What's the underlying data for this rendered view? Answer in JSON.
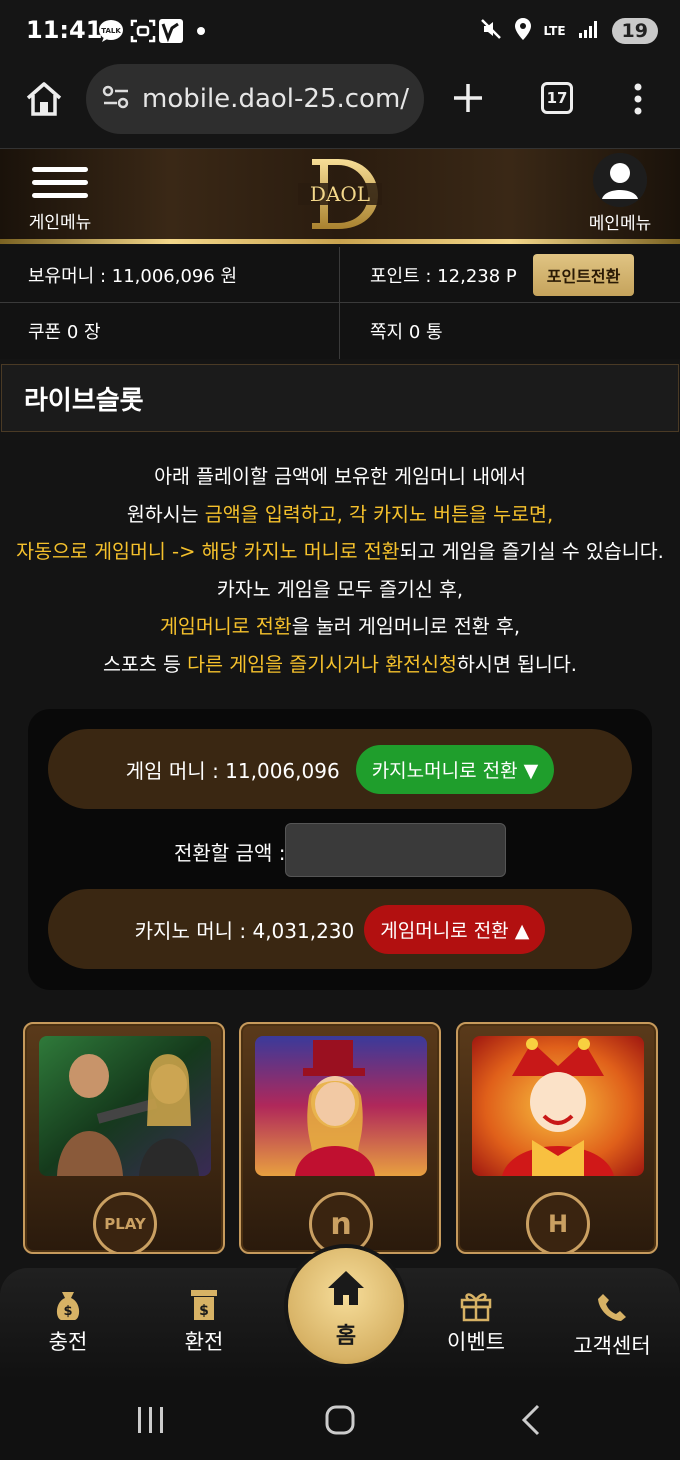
{
  "status_bar": {
    "time": "11:41",
    "network": "LTE",
    "battery": "19"
  },
  "browser": {
    "url": "mobile.daol-25.com/",
    "tab_count": "17"
  },
  "header": {
    "menu_label": "게인메뉴",
    "logo_text": "DAOL",
    "user_label": "메인메뉴"
  },
  "account": {
    "money": "보유머니 : 11,006,096 원",
    "points": "포인트 : 12,238 P",
    "points_button": "포인트전환",
    "coupon": "쿠폰 0 장",
    "messages": "쪽지 0 통"
  },
  "section": {
    "title": "라이브슬롯"
  },
  "instructions": {
    "line1": "아래 플레이할 금액에 보유한 게임머니 내에서",
    "line2_a": "원하시는 ",
    "line2_hl": "금액을 입력하고, 각 카지노 버튼을 누로면,",
    "line3_hl": "자동으로 게임머니 -> 해당 카지노 머니로 전환",
    "line3_b": "되고 게임을 즐기실 수 있습니다.",
    "line4": "카자노 게임을 모두 즐기신 후,",
    "line5_hl": "게임머니로 전환",
    "line5_b": "을 눌러 게임머니로 전환 후,",
    "line6_a": "스포츠 등 ",
    "line6_hl": "다른 게임을 즐기시거나 환전신청",
    "line6_b": "하시면 됩니다."
  },
  "converter": {
    "game_money": "게임 머니 : 11,006,096",
    "to_casino_button": "카지노머니로 전환 ▼",
    "amount_label": "전환할 금액 :",
    "amount_value": "",
    "casino_money": "카지노 머니 : 4,031,230",
    "to_game_button": "게임머니로 전환 ▲"
  },
  "games": [
    {
      "badge": "PLAY"
    },
    {
      "badge": "n"
    },
    {
      "badge": "H"
    }
  ],
  "bottom_nav": {
    "deposit": "충전",
    "withdraw": "환전",
    "home": "홈",
    "event": "이벤트",
    "support": "고객센터"
  },
  "colors": {
    "gold": "#d7b265",
    "highlight": "#f5c12c",
    "green": "#1f9e2c",
    "red": "#b21010"
  }
}
